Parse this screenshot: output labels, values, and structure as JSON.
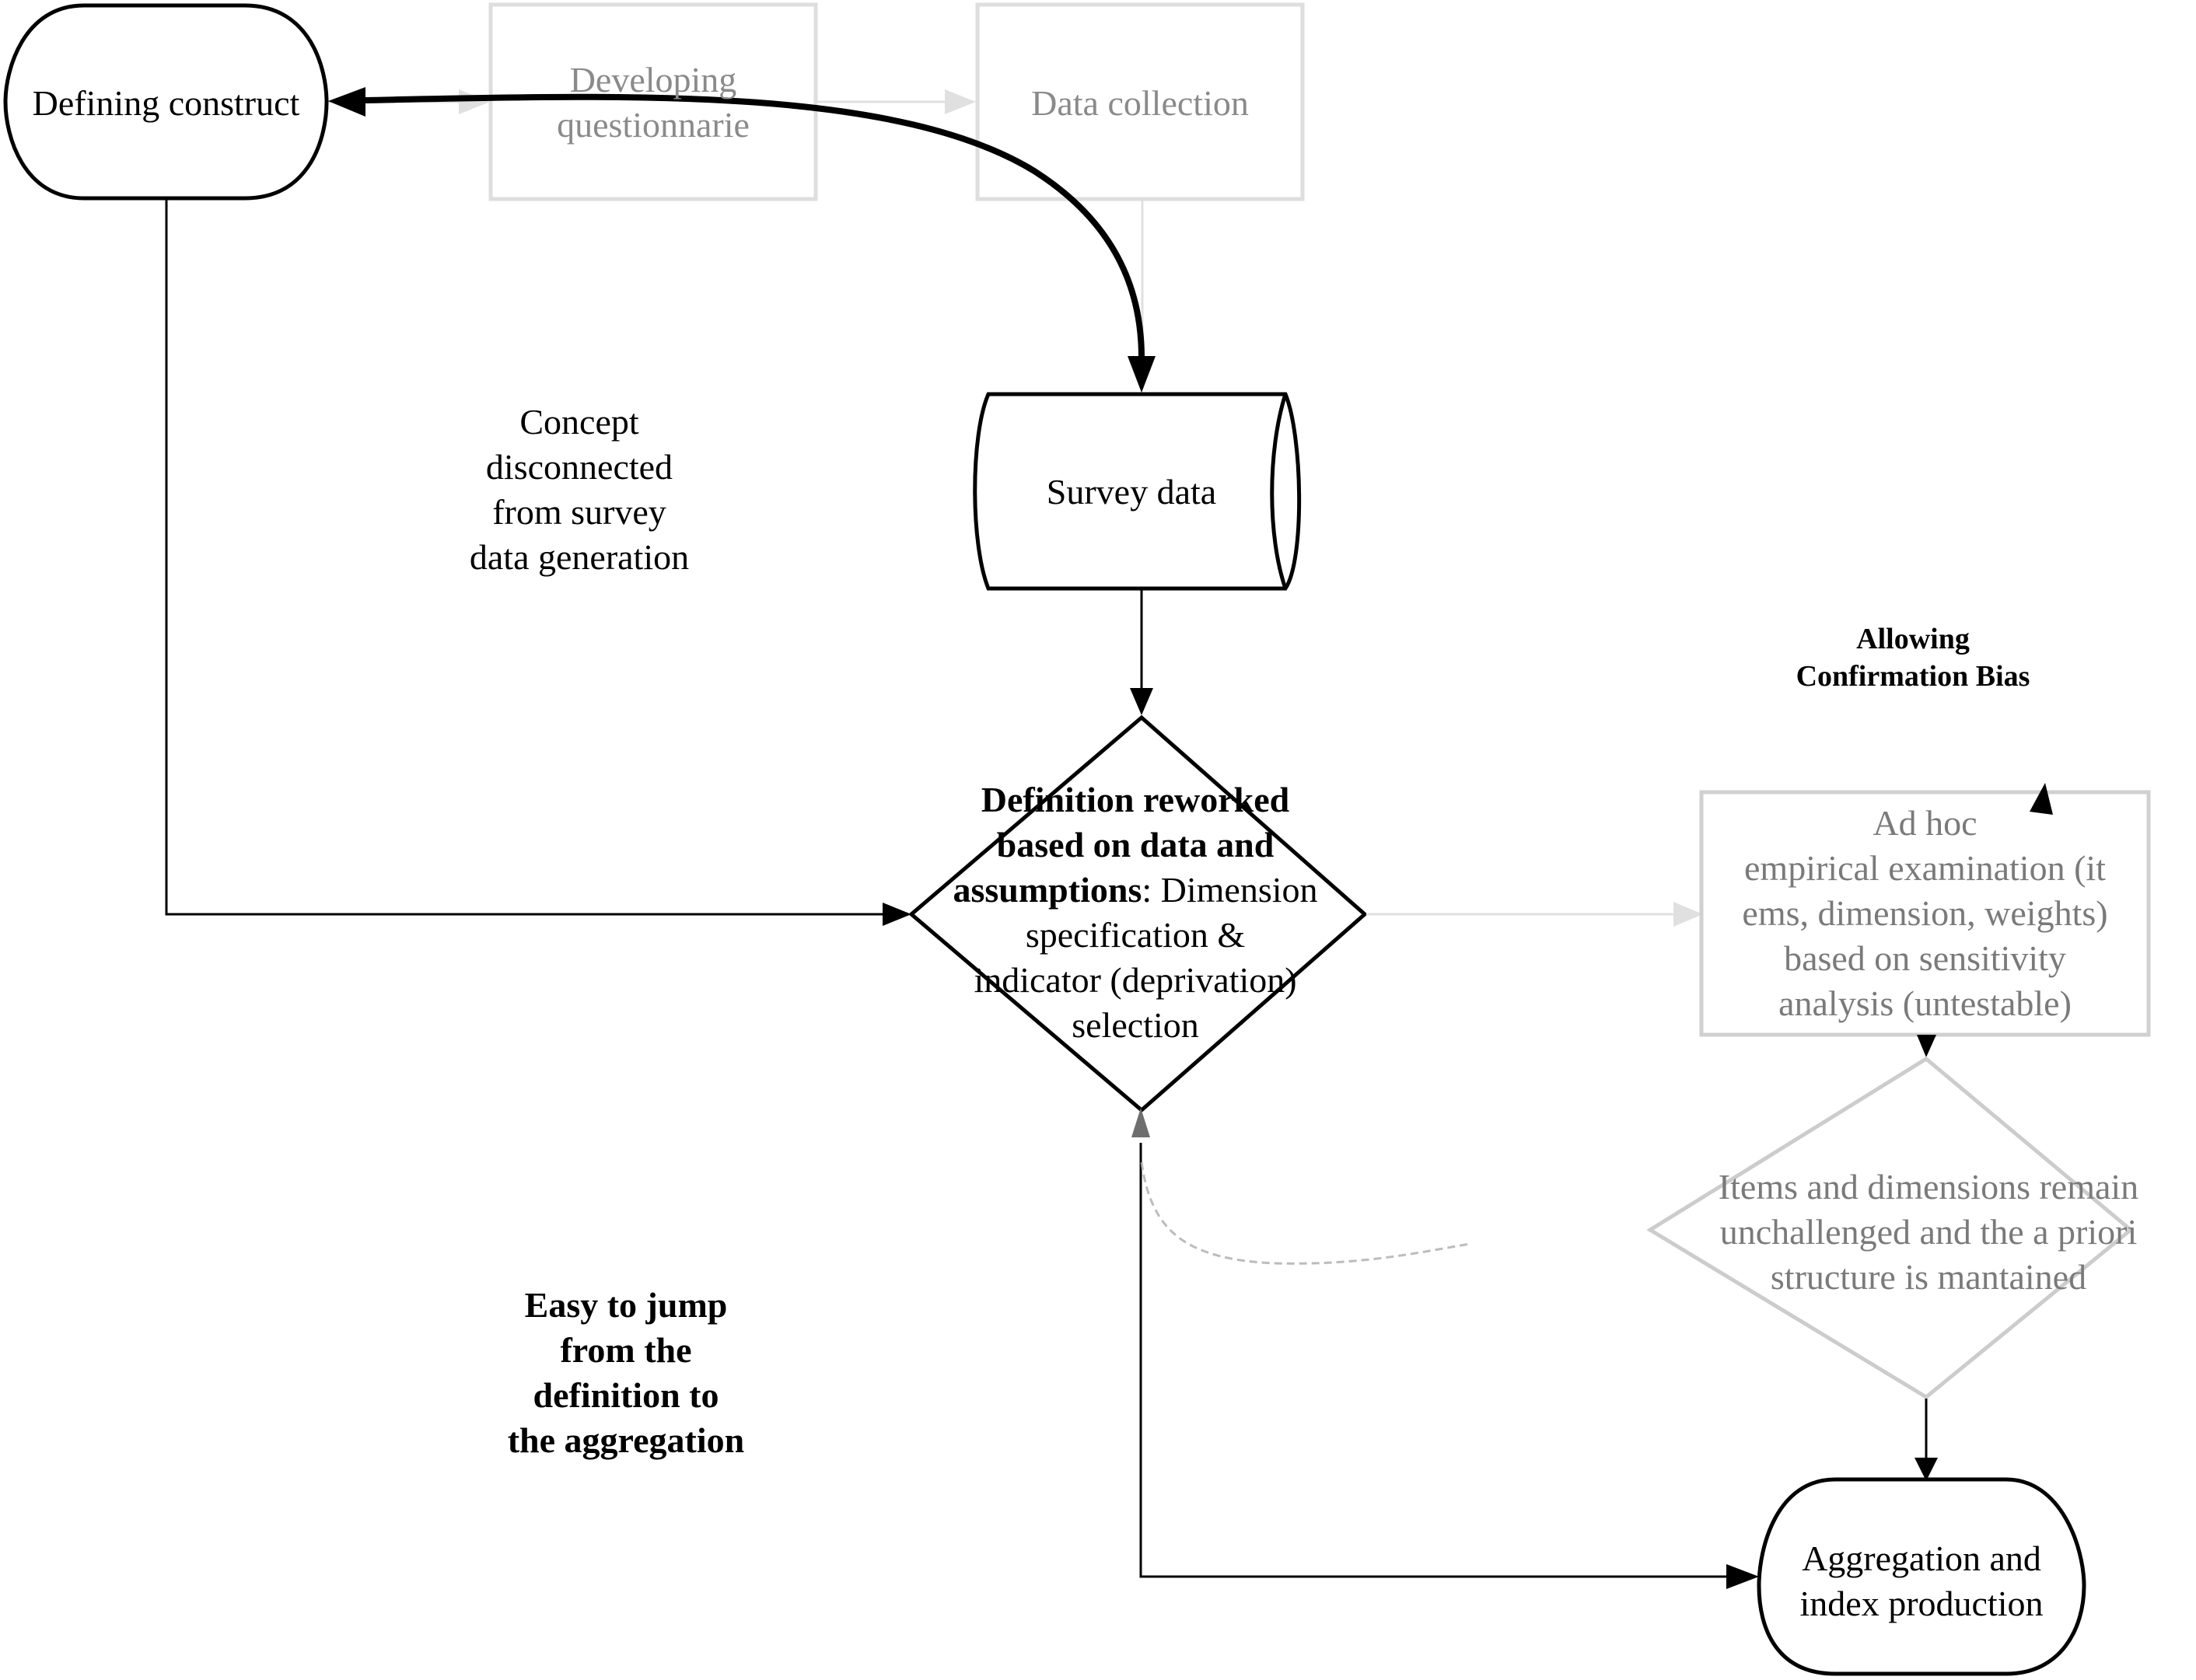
{
  "diagram": {
    "nodes": {
      "defining_construct": {
        "label": "Defining construct",
        "shape": "terminator",
        "style": "active"
      },
      "developing_questionnaire": {
        "lines": [
          "Developing",
          "questionnarie"
        ],
        "shape": "process",
        "style": "faded"
      },
      "data_collection": {
        "label": "Data collection",
        "shape": "process",
        "style": "faded"
      },
      "survey_data": {
        "label": "Survey data",
        "shape": "stored-data",
        "style": "active"
      },
      "definition_reworked": {
        "bold_lines": [
          "Definition reworked",
          "based on data and",
          "assumptions"
        ],
        "rest_of_line3": ": Dimension",
        "normal_lines": [
          "specification &",
          "indicator (deprivation)",
          "selection"
        ],
        "shape": "decision",
        "style": "active"
      },
      "ad_hoc_examination": {
        "lines": [
          "Ad hoc",
          "empirical examination (it",
          "ems, dimension, weights)",
          "based on sensitivity",
          "analysis (untestable)"
        ],
        "shape": "process",
        "style": "faded"
      },
      "items_unchallenged": {
        "lines": [
          "Items and dimensions remain",
          "unchallenged and the a priori",
          "structure is mantained"
        ],
        "shape": "decision",
        "style": "faded"
      },
      "aggregation": {
        "lines": [
          "Aggregation and",
          "index production"
        ],
        "shape": "terminator",
        "style": "active"
      }
    },
    "annotations": {
      "concept_disconnected": {
        "lines": [
          "Concept",
          "disconnected",
          "from survey",
          "data generation"
        ]
      },
      "easy_to_jump": {
        "lines": [
          "Easy to jump",
          "from the",
          "definition to",
          "the aggregation"
        ]
      },
      "confirmation_bias": {
        "lines": [
          "Allowing",
          "Confirmation Bias"
        ]
      }
    },
    "edges": [
      {
        "from": "defining_construct",
        "to": "developing_questionnaire",
        "style": "faded"
      },
      {
        "from": "developing_questionnaire",
        "to": "data_collection",
        "style": "faded"
      },
      {
        "from": "data_collection",
        "to": "survey_data",
        "style": "faded"
      },
      {
        "from": "survey_data",
        "to": "defining_construct",
        "style": "thick-bidirectional-curve"
      },
      {
        "from": "survey_data",
        "to": "definition_reworked",
        "style": "solid"
      },
      {
        "from": "defining_construct",
        "to": "definition_reworked",
        "style": "solid"
      },
      {
        "from": "definition_reworked",
        "to": "ad_hoc_examination",
        "style": "faded"
      },
      {
        "from": "ad_hoc_examination",
        "to": "items_unchallenged",
        "style": "solid"
      },
      {
        "from": "items_unchallenged",
        "to": "aggregation",
        "style": "solid"
      },
      {
        "from": "aggregation",
        "to": "definition_reworked",
        "style": "solid-bidirectional"
      },
      {
        "from": "items_unchallenged",
        "to": "definition_reworked",
        "style": "dashed-faded-curve"
      }
    ],
    "colors": {
      "active": "#000000",
      "faded_stroke": "#dddddd",
      "faded_text": "#8a8a8a",
      "faded_decision_stroke": "#cccccc",
      "dashed": "#999999",
      "up_arrow": "#6e6e6e"
    }
  }
}
